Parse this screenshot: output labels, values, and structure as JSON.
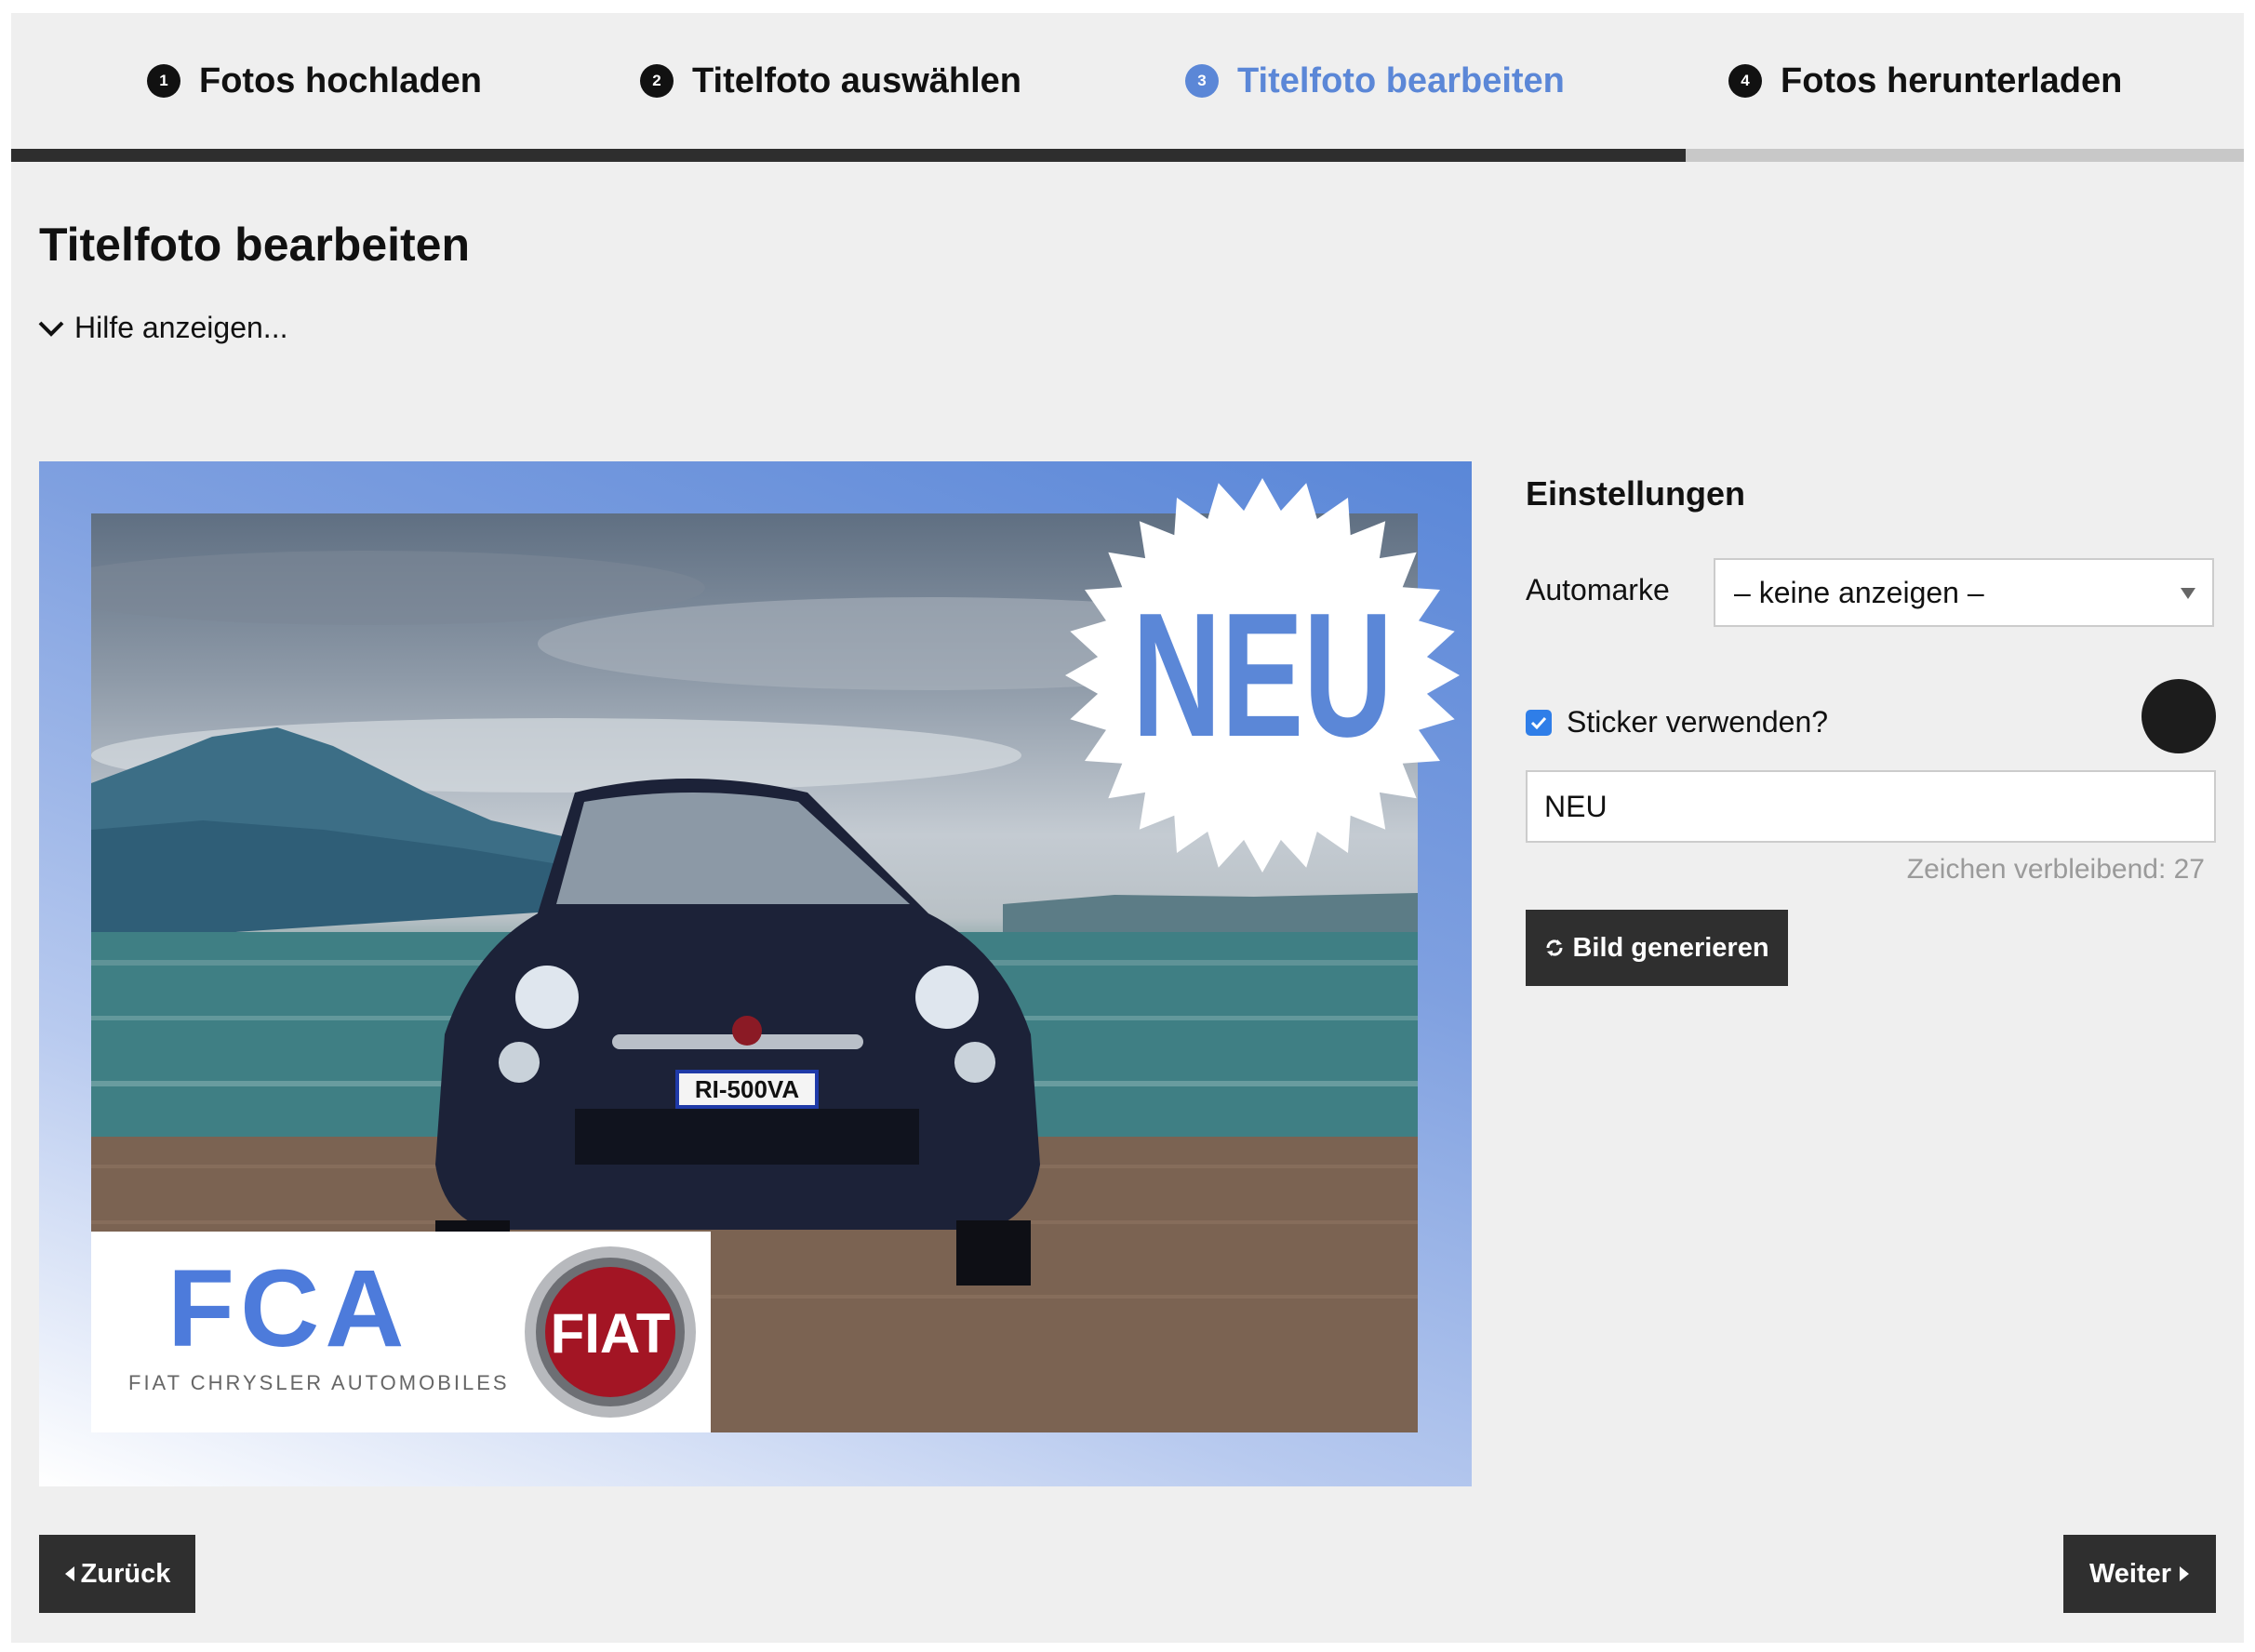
{
  "steps": [
    {
      "number": "1",
      "label": "Fotos hochladen",
      "state": "done"
    },
    {
      "number": "2",
      "label": "Titelfoto auswählen",
      "state": "done"
    },
    {
      "number": "3",
      "label": "Titelfoto bearbeiten",
      "state": "active"
    },
    {
      "number": "4",
      "label": "Fotos herunterladen",
      "state": "pending"
    }
  ],
  "progress": {
    "fraction": 0.75
  },
  "page": {
    "title": "Titelfoto bearbeiten",
    "help_label": "Hilfe anzeigen..."
  },
  "preview": {
    "sticker_text": "NEU",
    "logo_brand": "FCA",
    "logo_subtitle": "FIAT CHRYSLER AUTOMOBILES",
    "badge_text": "FIAT",
    "license_plate": "RI-500VA"
  },
  "settings": {
    "title": "Einstellungen",
    "automarke_label": "Automarke",
    "automarke_value": "– keine anzeigen –",
    "sticker_label": "Sticker verwenden?",
    "sticker_checked": true,
    "sticker_color": "#1c1c1c",
    "sticker_text_value": "NEU",
    "remaining_label": "Zeichen verbleibend: 27",
    "generate_label": "Bild generieren"
  },
  "nav": {
    "back_label": "Zurück",
    "next_label": "Weiter"
  },
  "colors": {
    "accent": "#5b87d7",
    "dark_button": "#2f2f2f",
    "checkbox": "#2f7ee8"
  }
}
